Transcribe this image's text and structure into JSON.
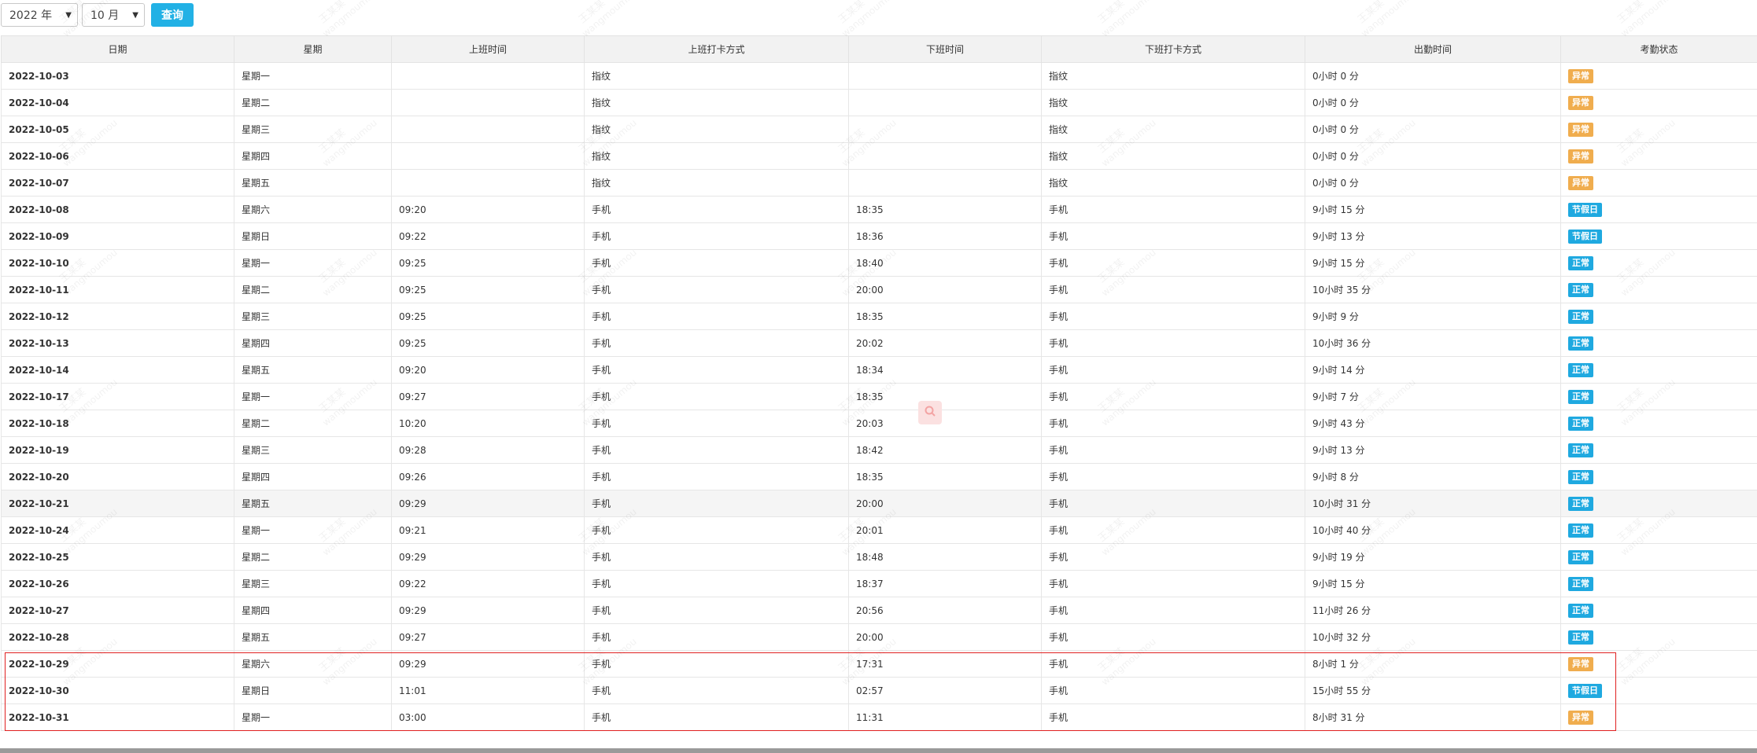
{
  "toolbar": {
    "year_value": "2022 年",
    "month_value": "10 月",
    "query_label": "查询"
  },
  "table": {
    "columns": [
      "日期",
      "星期",
      "上班时间",
      "上班打卡方式",
      "下班时间",
      "下班打卡方式",
      "出勤时间",
      "考勤状态"
    ],
    "rows": [
      {
        "date": "2022-10-03",
        "weekday": "星期一",
        "on_time": "",
        "on_method": "指纹",
        "off_time": "",
        "off_method": "指纹",
        "duration": "0小时 0 分",
        "status": "异常",
        "status_type": "warn"
      },
      {
        "date": "2022-10-04",
        "weekday": "星期二",
        "on_time": "",
        "on_method": "指纹",
        "off_time": "",
        "off_method": "指纹",
        "duration": "0小时 0 分",
        "status": "异常",
        "status_type": "warn"
      },
      {
        "date": "2022-10-05",
        "weekday": "星期三",
        "on_time": "",
        "on_method": "指纹",
        "off_time": "",
        "off_method": "指纹",
        "duration": "0小时 0 分",
        "status": "异常",
        "status_type": "warn"
      },
      {
        "date": "2022-10-06",
        "weekday": "星期四",
        "on_time": "",
        "on_method": "指纹",
        "off_time": "",
        "off_method": "指纹",
        "duration": "0小时 0 分",
        "status": "异常",
        "status_type": "warn"
      },
      {
        "date": "2022-10-07",
        "weekday": "星期五",
        "on_time": "",
        "on_method": "指纹",
        "off_time": "",
        "off_method": "指纹",
        "duration": "0小时 0 分",
        "status": "异常",
        "status_type": "warn"
      },
      {
        "date": "2022-10-08",
        "weekday": "星期六",
        "on_time": "09:20",
        "on_method": "手机",
        "off_time": "18:35",
        "off_method": "手机",
        "duration": "9小时 15 分",
        "status": "节假日",
        "status_type": "info"
      },
      {
        "date": "2022-10-09",
        "weekday": "星期日",
        "on_time": "09:22",
        "on_method": "手机",
        "off_time": "18:36",
        "off_method": "手机",
        "duration": "9小时 13 分",
        "status": "节假日",
        "status_type": "info"
      },
      {
        "date": "2022-10-10",
        "weekday": "星期一",
        "on_time": "09:25",
        "on_method": "手机",
        "off_time": "18:40",
        "off_method": "手机",
        "duration": "9小时 15 分",
        "status": "正常",
        "status_type": "info"
      },
      {
        "date": "2022-10-11",
        "weekday": "星期二",
        "on_time": "09:25",
        "on_method": "手机",
        "off_time": "20:00",
        "off_method": "手机",
        "duration": "10小时 35 分",
        "status": "正常",
        "status_type": "info"
      },
      {
        "date": "2022-10-12",
        "weekday": "星期三",
        "on_time": "09:25",
        "on_method": "手机",
        "off_time": "18:35",
        "off_method": "手机",
        "duration": "9小时 9 分",
        "status": "正常",
        "status_type": "info"
      },
      {
        "date": "2022-10-13",
        "weekday": "星期四",
        "on_time": "09:25",
        "on_method": "手机",
        "off_time": "20:02",
        "off_method": "手机",
        "duration": "10小时 36 分",
        "status": "正常",
        "status_type": "info"
      },
      {
        "date": "2022-10-14",
        "weekday": "星期五",
        "on_time": "09:20",
        "on_method": "手机",
        "off_time": "18:34",
        "off_method": "手机",
        "duration": "9小时 14 分",
        "status": "正常",
        "status_type": "info"
      },
      {
        "date": "2022-10-17",
        "weekday": "星期一",
        "on_time": "09:27",
        "on_method": "手机",
        "off_time": "18:35",
        "off_method": "手机",
        "duration": "9小时 7 分",
        "status": "正常",
        "status_type": "info"
      },
      {
        "date": "2022-10-18",
        "weekday": "星期二",
        "on_time": "10:20",
        "on_method": "手机",
        "off_time": "20:03",
        "off_method": "手机",
        "duration": "9小时 43 分",
        "status": "正常",
        "status_type": "info"
      },
      {
        "date": "2022-10-19",
        "weekday": "星期三",
        "on_time": "09:28",
        "on_method": "手机",
        "off_time": "18:42",
        "off_method": "手机",
        "duration": "9小时 13 分",
        "status": "正常",
        "status_type": "info"
      },
      {
        "date": "2022-10-20",
        "weekday": "星期四",
        "on_time": "09:26",
        "on_method": "手机",
        "off_time": "18:35",
        "off_method": "手机",
        "duration": "9小时 8 分",
        "status": "正常",
        "status_type": "info"
      },
      {
        "date": "2022-10-21",
        "weekday": "星期五",
        "on_time": "09:29",
        "on_method": "手机",
        "off_time": "20:00",
        "off_method": "手机",
        "duration": "10小时 31 分",
        "status": "正常",
        "status_type": "info",
        "highlight": true
      },
      {
        "date": "2022-10-24",
        "weekday": "星期一",
        "on_time": "09:21",
        "on_method": "手机",
        "off_time": "20:01",
        "off_method": "手机",
        "duration": "10小时 40 分",
        "status": "正常",
        "status_type": "info"
      },
      {
        "date": "2022-10-25",
        "weekday": "星期二",
        "on_time": "09:29",
        "on_method": "手机",
        "off_time": "18:48",
        "off_method": "手机",
        "duration": "9小时 19 分",
        "status": "正常",
        "status_type": "info"
      },
      {
        "date": "2022-10-26",
        "weekday": "星期三",
        "on_time": "09:22",
        "on_method": "手机",
        "off_time": "18:37",
        "off_method": "手机",
        "duration": "9小时 15 分",
        "status": "正常",
        "status_type": "info"
      },
      {
        "date": "2022-10-27",
        "weekday": "星期四",
        "on_time": "09:29",
        "on_method": "手机",
        "off_time": "20:56",
        "off_method": "手机",
        "duration": "11小时 26 分",
        "status": "正常",
        "status_type": "info"
      },
      {
        "date": "2022-10-28",
        "weekday": "星期五",
        "on_time": "09:27",
        "on_method": "手机",
        "off_time": "20:00",
        "off_method": "手机",
        "duration": "10小时 32 分",
        "status": "正常",
        "status_type": "info"
      },
      {
        "date": "2022-10-29",
        "weekday": "星期六",
        "on_time": "09:29",
        "on_method": "手机",
        "off_time": "17:31",
        "off_method": "手机",
        "duration": "8小时 1 分",
        "status": "异常",
        "status_type": "warn"
      },
      {
        "date": "2022-10-30",
        "weekday": "星期日",
        "on_time": "11:01",
        "on_method": "手机",
        "off_time": "02:57",
        "off_method": "手机",
        "duration": "15小时 55 分",
        "status": "节假日",
        "status_type": "info"
      },
      {
        "date": "2022-10-31",
        "weekday": "星期一",
        "on_time": "03:00",
        "on_method": "手机",
        "off_time": "11:31",
        "off_method": "手机",
        "duration": "8小时 31 分",
        "status": "异常",
        "status_type": "warn"
      }
    ]
  },
  "watermark": {
    "name": "王某某",
    "id": "wangmoumou"
  },
  "colors": {
    "primary": "#22b1e5",
    "warn_badge": "#f0ad4e",
    "info_badge": "#1fa9e0",
    "highlight_border": "#e02020"
  },
  "icons": {
    "floating": "search-icon"
  }
}
